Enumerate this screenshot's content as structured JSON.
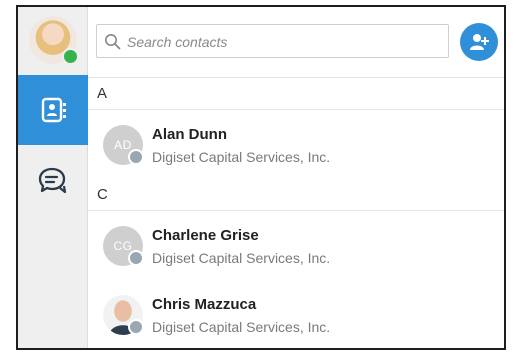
{
  "user": {
    "status_color": "#36b34a",
    "icon": "user-avatar"
  },
  "nav": [
    {
      "id": "contacts",
      "icon": "contact-card-icon",
      "active": true
    },
    {
      "id": "chat",
      "icon": "chat-bubbles-icon",
      "active": false
    }
  ],
  "search": {
    "placeholder": "Search contacts",
    "value": "",
    "icon": "search-icon"
  },
  "add_contact": {
    "icon": "add-user-icon"
  },
  "colors": {
    "accent": "#2f8fd8",
    "online": "#36b34a",
    "offline_status": "#9aa7b3"
  },
  "sections": [
    {
      "letter": "A",
      "contacts": [
        {
          "initials": "AD",
          "name": "Alan Dunn",
          "company": "Digiset Capital Services, Inc."
        }
      ]
    },
    {
      "letter": "C",
      "contacts": [
        {
          "initials": "CG",
          "name": "Charlene Grise",
          "company": "Digiset Capital Services, Inc."
        },
        {
          "initials": "",
          "name": "Chris Mazzuca",
          "company": "Digiset Capital Services, Inc."
        }
      ]
    }
  ]
}
